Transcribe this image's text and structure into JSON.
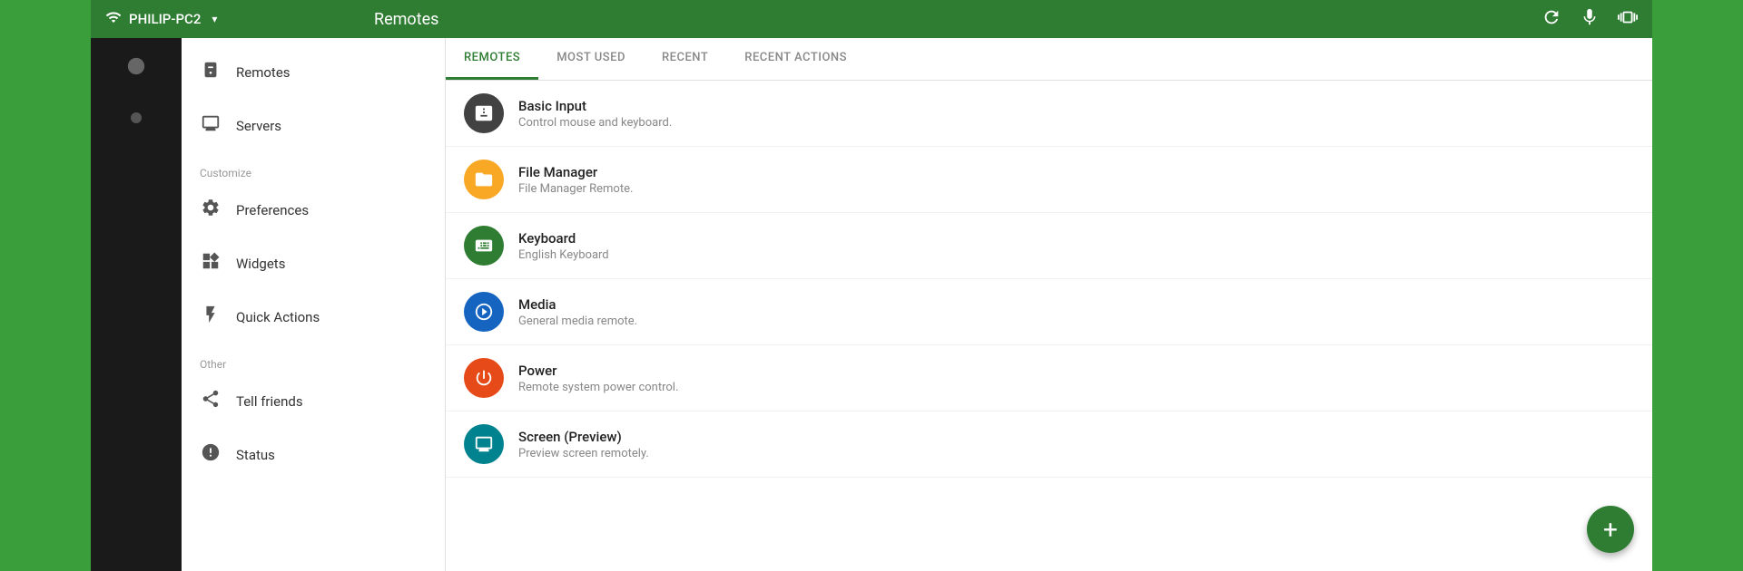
{
  "topBar": {
    "deviceName": "PHILIP-PC2",
    "title": "Remotes",
    "refreshLabel": "refresh",
    "micLabel": "microphone",
    "vibrateLabel": "vibrate"
  },
  "tabs": [
    {
      "id": "remotes",
      "label": "REMOTES",
      "active": true
    },
    {
      "id": "most-used",
      "label": "MOST USED",
      "active": false
    },
    {
      "id": "recent",
      "label": "RECENT",
      "active": false
    },
    {
      "id": "recent-actions",
      "label": "RECENT ACTIONS",
      "active": false
    }
  ],
  "navDrawer": {
    "sectionMain": "",
    "items": [
      {
        "id": "remotes",
        "label": "Remotes",
        "icon": "remote"
      },
      {
        "id": "servers",
        "label": "Servers",
        "icon": "monitor"
      }
    ],
    "sectionCustomize": "Customize",
    "customizeItems": [
      {
        "id": "preferences",
        "label": "Preferences",
        "icon": "gear"
      },
      {
        "id": "widgets",
        "label": "Widgets",
        "icon": "widgets"
      },
      {
        "id": "quick-actions",
        "label": "Quick Actions",
        "icon": "bolt"
      }
    ],
    "sectionOther": "Other",
    "otherItems": [
      {
        "id": "tell-friends",
        "label": "Tell friends",
        "icon": "share"
      },
      {
        "id": "status",
        "label": "Status",
        "icon": "status"
      }
    ]
  },
  "remotes": [
    {
      "id": "basic-input",
      "name": "Basic Input",
      "desc": "Control mouse and keyboard.",
      "colorClass": "icon-dark",
      "icon": "mouse"
    },
    {
      "id": "file-manager",
      "name": "File Manager",
      "desc": "File Manager Remote.",
      "colorClass": "icon-yellow",
      "icon": "folder"
    },
    {
      "id": "keyboard",
      "name": "Keyboard",
      "desc": "English Keyboard",
      "colorClass": "icon-green",
      "icon": "keyboard"
    },
    {
      "id": "media",
      "name": "Media",
      "desc": "General media remote.",
      "colorClass": "icon-blue",
      "icon": "play"
    },
    {
      "id": "power",
      "name": "Power",
      "desc": "Remote system power control.",
      "colorClass": "icon-orange",
      "icon": "power"
    },
    {
      "id": "screen-preview",
      "name": "Screen (Preview)",
      "desc": "Preview screen remotely.",
      "colorClass": "icon-teal",
      "icon": "screen"
    }
  ],
  "fab": {
    "label": "+"
  }
}
